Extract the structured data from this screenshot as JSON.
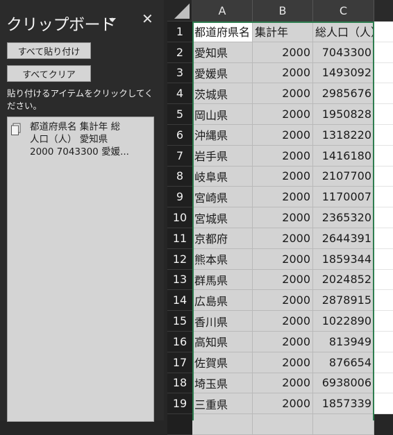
{
  "clipboard": {
    "title": "クリップボード",
    "paste_all": "すべて貼り付け",
    "clear_all": "すべてクリア",
    "instruction": "貼り付けるアイテムをクリックしてください。",
    "item_lines": [
      "都道府県名 集計年 総",
      "人口（人） 愛知県",
      "2000 7043300 愛媛..."
    ]
  },
  "sheet": {
    "columns": [
      "A",
      "B",
      "C"
    ],
    "rows": [
      {
        "num": "1",
        "a": "都道府県名",
        "b": "集計年",
        "c": "総人口（人）"
      },
      {
        "num": "2",
        "a": "愛知県",
        "b": "2000",
        "c": "7043300"
      },
      {
        "num": "3",
        "a": "愛媛県",
        "b": "2000",
        "c": "1493092"
      },
      {
        "num": "4",
        "a": "茨城県",
        "b": "2000",
        "c": "2985676"
      },
      {
        "num": "5",
        "a": "岡山県",
        "b": "2000",
        "c": "1950828"
      },
      {
        "num": "6",
        "a": "沖縄県",
        "b": "2000",
        "c": "1318220"
      },
      {
        "num": "7",
        "a": "岩手県",
        "b": "2000",
        "c": "1416180"
      },
      {
        "num": "8",
        "a": "岐阜県",
        "b": "2000",
        "c": "2107700"
      },
      {
        "num": "9",
        "a": "宮崎県",
        "b": "2000",
        "c": "1170007"
      },
      {
        "num": "10",
        "a": "宮城県",
        "b": "2000",
        "c": "2365320"
      },
      {
        "num": "11",
        "a": "京都府",
        "b": "2000",
        "c": "2644391"
      },
      {
        "num": "12",
        "a": "熊本県",
        "b": "2000",
        "c": "1859344"
      },
      {
        "num": "13",
        "a": "群馬県",
        "b": "2000",
        "c": "2024852"
      },
      {
        "num": "14",
        "a": "広島県",
        "b": "2000",
        "c": "2878915"
      },
      {
        "num": "15",
        "a": "香川県",
        "b": "2000",
        "c": "1022890"
      },
      {
        "num": "16",
        "a": "高知県",
        "b": "2000",
        "c": "813949"
      },
      {
        "num": "17",
        "a": "佐賀県",
        "b": "2000",
        "c": "876654"
      },
      {
        "num": "18",
        "a": "埼玉県",
        "b": "2000",
        "c": "6938006"
      },
      {
        "num": "19",
        "a": "三重県",
        "b": "2000",
        "c": "1857339"
      }
    ]
  }
}
